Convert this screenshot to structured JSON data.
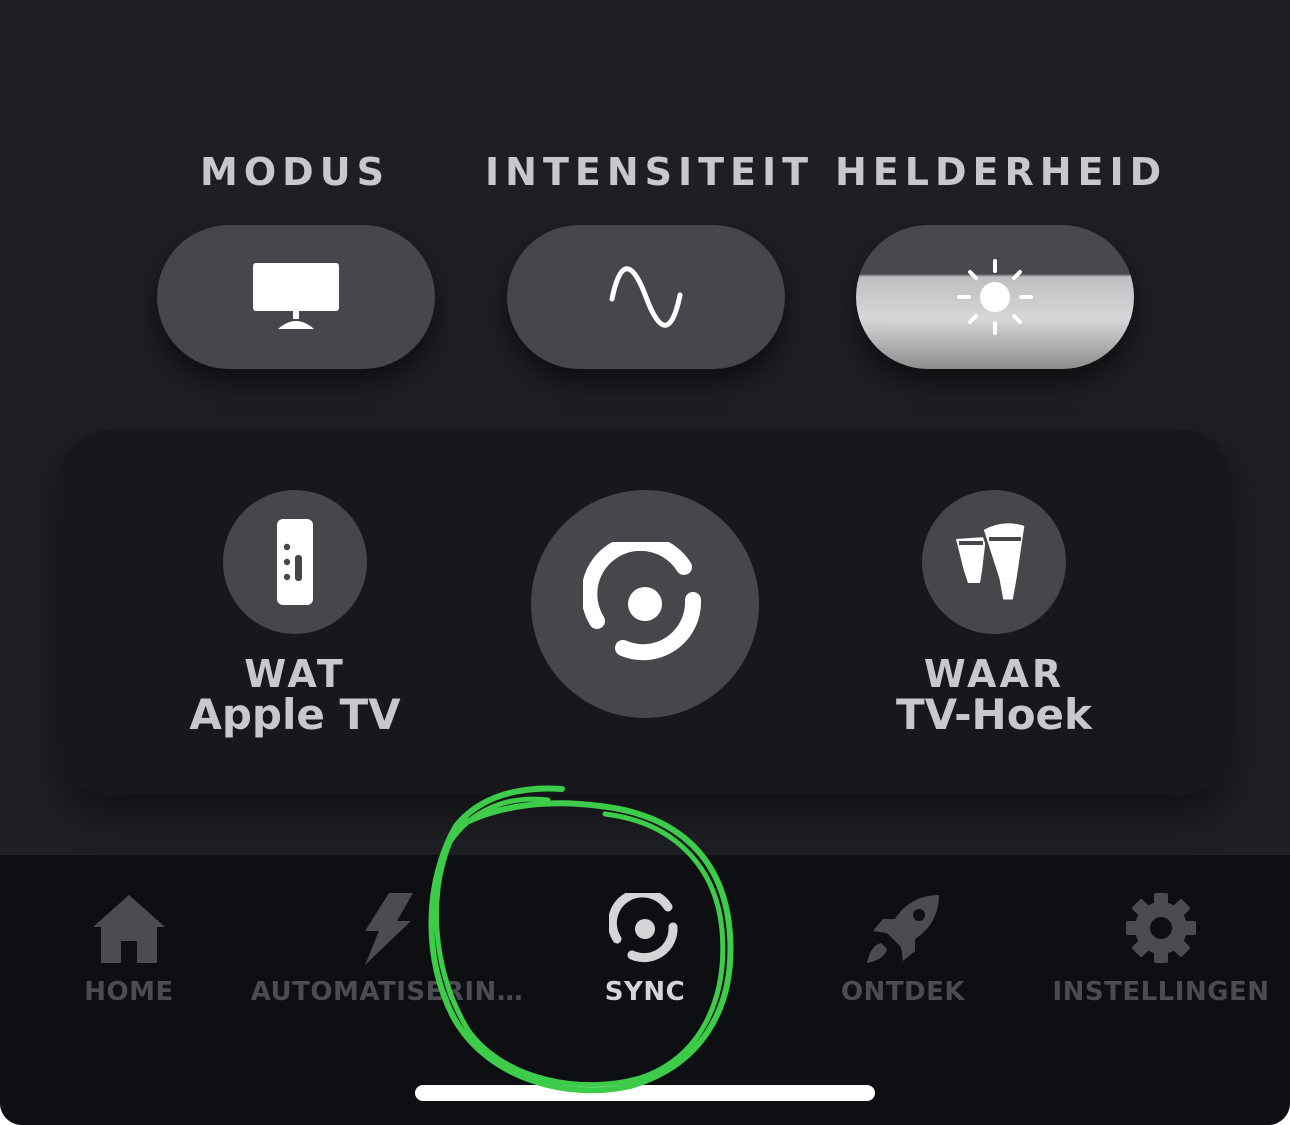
{
  "controls": {
    "mode_label": "MODUS",
    "intensity_label": "INTENSITEIT",
    "brightness_label": "HELDERHEID"
  },
  "selection": {
    "what_title": "WAT",
    "what_value": "Apple TV",
    "where_title": "WAAR",
    "where_value": "TV-Hoek"
  },
  "tabs": [
    {
      "label": "HOME",
      "icon": "home-icon"
    },
    {
      "label": "AUTOMATISERIN…",
      "icon": "lightning-icon"
    },
    {
      "label": "SYNC",
      "icon": "sync-icon",
      "active": true
    },
    {
      "label": "ONTDEK",
      "icon": "rocket-icon"
    },
    {
      "label": "INSTELLINGEN",
      "icon": "gear-icon"
    }
  ],
  "colors": {
    "background": "#1e1f23",
    "panel": "#17181c",
    "button": "#46474b",
    "tabbar": "#0e0f12",
    "active_text": "#d4d5d7",
    "inactive_text": "#4b4c50",
    "annotation": "#3dcc4a"
  }
}
